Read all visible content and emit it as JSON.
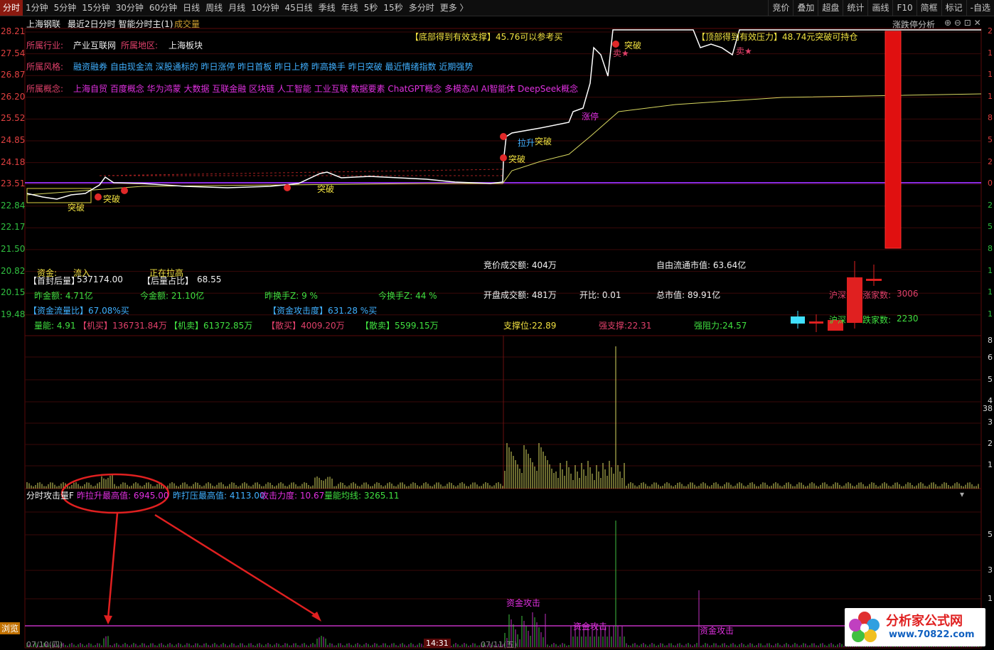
{
  "toolbar": {
    "periods": [
      "分时",
      "1分钟",
      "5分钟",
      "15分钟",
      "30分钟",
      "60分钟",
      "日线",
      "周线",
      "月线",
      "10分钟",
      "45日线",
      "季线",
      "年线",
      "5秒",
      "15秒",
      "多分时",
      "更多 〉"
    ],
    "tools": [
      "竞价",
      "叠加",
      "超盘",
      "统计",
      "画线",
      "F10",
      "简框",
      "标记",
      "-自选"
    ]
  },
  "header": {
    "stock_name": "上海钢联",
    "view_title": "最近2日分时 智能分时主(1)",
    "volume_tab": "成交量",
    "right_tab": "涨跌停分析"
  },
  "price_axis": [
    "28.21",
    "27.54",
    "26.87",
    "26.20",
    "25.52",
    "24.85",
    "24.18",
    "23.51",
    "22.84",
    "22.17",
    "21.50",
    "20.82",
    "20.15",
    "19.48"
  ],
  "pct_axis": [
    "2",
    "1",
    "1",
    "1",
    "8",
    "5",
    "2",
    "0",
    "2",
    "5",
    "8",
    "1",
    "1",
    "1"
  ],
  "info": {
    "industry_label": "所属行业:",
    "industry": "产业互联网",
    "region_label": "所属地区:",
    "region": "上海板块",
    "style_label": "所属风格:",
    "style": "融资融券 自由现金流 深股通标的 昨日涨停 昨日首板 昨日上榜 昨高换手 昨日突破 最近情绪指数 近期强势",
    "concept_label": "所属概念:",
    "concept": "上海自贸 百度概念 华为鸿蒙 大数据 互联金融 区块链 人工智能 工业互联 数据要素 ChatGPT概念 多模态AI AI智能体 DeepSeek概念"
  },
  "annotations": {
    "support": "【底部得到有效支撑】45.76可以参考买",
    "resistance": "【顶部得到有效压力】48.74元突破可持仓",
    "break": "突破",
    "pull": "拉升",
    "limit": "涨停",
    "sell": "卖★"
  },
  "stats": {
    "fund_label": "资金:",
    "fund_val": "流入",
    "raising": "正在拉高",
    "seal_label": "【首封后量】",
    "seal_val": "537174.00",
    "ratio_label": "【后量占比】",
    "ratio_val": "68.55",
    "yest_amount": "昨金额: 4.71亿",
    "today_amount": "今金额: 21.10亿",
    "yest_turn": "昨换手Z:  9  %",
    "today_turn": "今换手Z:  44  %",
    "flow_ratio": "【资金流量比】67.08%买",
    "attack": "【资金攻击度】631.28 %买",
    "vol_energy": "量能: 4.91",
    "inst_buy": "【机买】136731.84万",
    "inst_sell": "【机卖】61372.85万",
    "retail_buy": "【散买】4009.20万",
    "retail_sell": "【散卖】5599.15万",
    "support_lvl": "支撑位:22.89",
    "strong_support": "强支撑:22.31",
    "strong_resist": "强阻力:24.57",
    "auction_amount": "竞价成交额: 404万",
    "open_amount": "开盘成交额: 481万",
    "open_ratio": "开比: 0.01",
    "float_cap": "自由流通市值: 63.64亿",
    "total_cap": "总市值: 89.91亿",
    "hs_label": "沪深",
    "up_label": "涨家数:",
    "up_val": "3006",
    "down_label": "跌家数:",
    "down_val": "2230",
    "hs_label2": "沪深"
  },
  "sub_axis": [
    "8",
    "6",
    "5",
    "4",
    "3",
    "2",
    "1",
    "38"
  ],
  "bottom_axis": [
    "5",
    "3",
    "1"
  ],
  "indicator": {
    "name": "分时攻击量F",
    "max_pull": "昨拉升最高值: 6945.00",
    "max_press": "昨打压最高值: 4113.00",
    "force": "攻击力度: 10.67",
    "avg": "量能均线: 3265.11",
    "attack_tag": "资金攻击"
  },
  "footer": {
    "mode": "浏览",
    "date1": "07/10(四)",
    "time": "14:31",
    "date2": "07/11(五)"
  },
  "watermark": {
    "brand": "分析家公式网",
    "url": "www.70822.com"
  },
  "colors": {
    "price_line": "#ffffff",
    "avg_line": "#d8d860",
    "baseline": "#8a2be2",
    "up": "#e02020",
    "down": "#20c0ff",
    "volume": "#d8d860"
  }
}
